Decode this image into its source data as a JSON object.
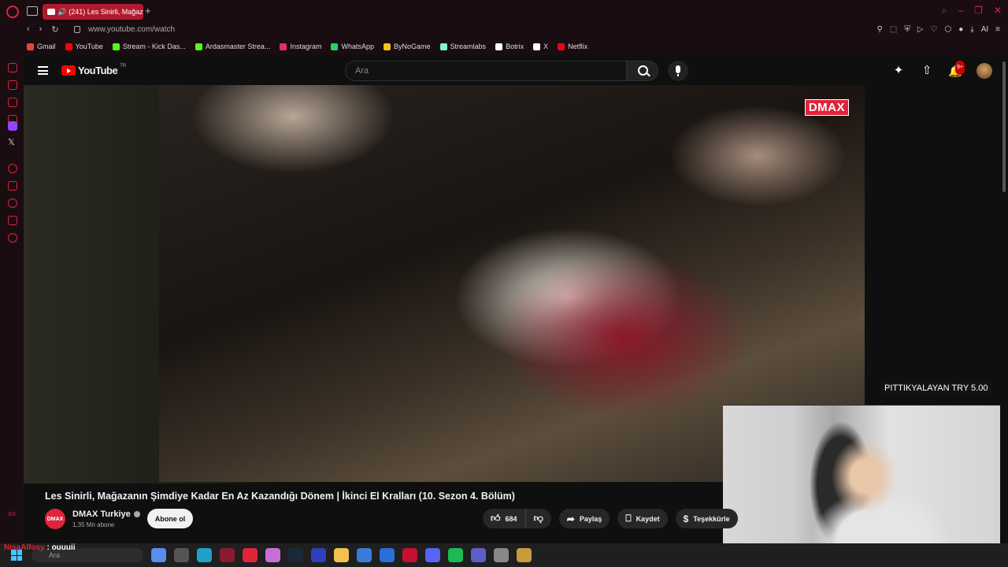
{
  "browser": {
    "tab_title": "(241) Les Sinirli, Mağaz",
    "url": "www.youtube.com/watch",
    "ai_label": "AI",
    "bookmarks": [
      {
        "label": "Gmail",
        "color": "#ea4335"
      },
      {
        "label": "YouTube",
        "color": "#ff0000"
      },
      {
        "label": "Stream - Kick Das...",
        "color": "#53fc18"
      },
      {
        "label": "Ardasmaster Strea...",
        "color": "#53fc18"
      },
      {
        "label": "Instagram",
        "color": "#e1306c"
      },
      {
        "label": "WhatsApp",
        "color": "#25d366"
      },
      {
        "label": "ByNoGame",
        "color": "#f5c518"
      },
      {
        "label": "Streamlabs",
        "color": "#80f5d2"
      },
      {
        "label": "Botrix",
        "color": "#ffffff"
      },
      {
        "label": "X",
        "color": "#ffffff"
      },
      {
        "label": "Netflix",
        "color": "#e50914"
      }
    ]
  },
  "youtube": {
    "logo_text": "YouTube",
    "country_code": "TR",
    "search_placeholder": "Ara",
    "notifications_badge": "9+",
    "video": {
      "channel_watermark": "DMAX",
      "title": "Les Sinirli, Mağazanın Şimdiye Kadar En Az Kazandığı Dönem | İkinci El Kralları (10. Sezon 4. Bölüm)",
      "channel_avatar_text": "DMAX",
      "channel_name": "DMAX Turkiye",
      "subscribers": "1,35 Mn abone",
      "subscribe_label": "Abone ol",
      "likes": "684",
      "share_label": "Paylaş",
      "save_label": "Kaydet",
      "thanks_label": "Teşekkürle"
    }
  },
  "stream_overlay": {
    "donation_text": "PITTIKYALAYAN  TRY 5.00",
    "chat_user": "NisaAlfosy",
    "chat_message": " : ouuuii"
  },
  "taskbar": {
    "search_placeholder": "Ara",
    "apps": [
      {
        "name": "copilot",
        "color": "#5a8dee"
      },
      {
        "name": "task-view",
        "color": "#555555"
      },
      {
        "name": "edge",
        "color": "#1fa2c7"
      },
      {
        "name": "app-red",
        "color": "#8a1a2e"
      },
      {
        "name": "opera-gx",
        "color": "#e0243a"
      },
      {
        "name": "app-multi",
        "color": "#c86fd6"
      },
      {
        "name": "steam",
        "color": "#1b2838"
      },
      {
        "name": "app-blue",
        "color": "#2f3fbf"
      },
      {
        "name": "file-explorer",
        "color": "#f2c14e"
      },
      {
        "name": "store",
        "color": "#3b7bd6"
      },
      {
        "name": "mail",
        "color": "#2a6fd6"
      },
      {
        "name": "app-red-circle",
        "color": "#c8102e"
      },
      {
        "name": "discord",
        "color": "#5865f2"
      },
      {
        "name": "spotify",
        "color": "#1db954"
      },
      {
        "name": "teams",
        "color": "#5b5fc7"
      },
      {
        "name": "app-dial",
        "color": "#888888"
      },
      {
        "name": "league",
        "color": "#c89b3c"
      }
    ]
  }
}
